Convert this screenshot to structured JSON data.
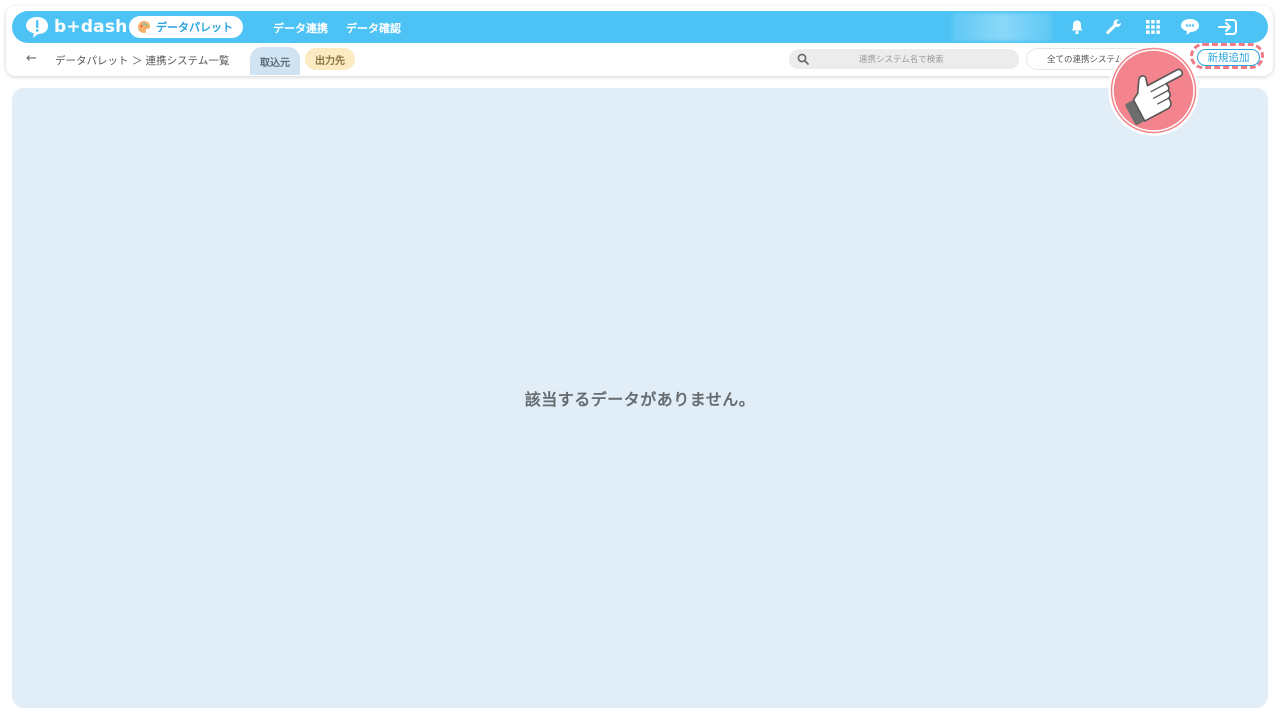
{
  "app": {
    "logo_text": "b+dash",
    "palette_label": "データパレット"
  },
  "nav": [
    {
      "label": "データ連携"
    },
    {
      "label": "データ確認"
    }
  ],
  "breadcrumb": {
    "text": "データパレット ＞ 連携システム一覧"
  },
  "tabs": [
    {
      "label": "取込元"
    },
    {
      "label": "出力先"
    }
  ],
  "search": {
    "placeholder": "連携システム名で検索"
  },
  "filter": {
    "value": "全ての連携システム"
  },
  "add_button": {
    "label": "新規追加"
  },
  "main": {
    "empty_message": "該当するデータがありません。"
  },
  "colors": {
    "accent": "#4dc3f5",
    "content_bg": "#e1eef8",
    "highlight": "#f07a86"
  },
  "icons": [
    "bell-icon",
    "wrench-icon",
    "grid-icon",
    "chat-icon",
    "logout-icon",
    "search-icon",
    "back-arrow-icon",
    "pointing-hand-icon"
  ]
}
